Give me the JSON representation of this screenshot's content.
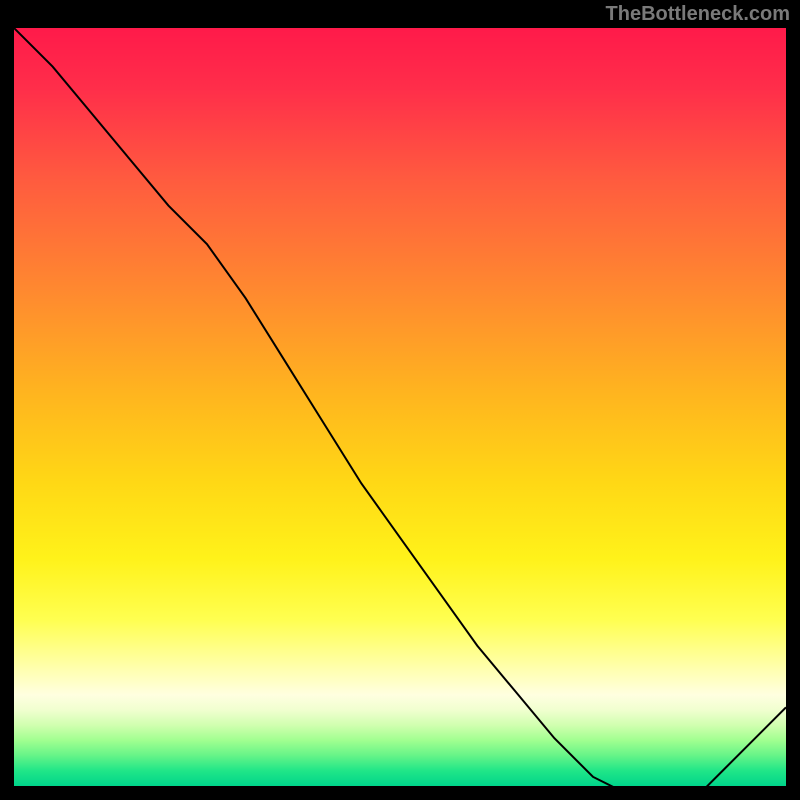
{
  "attribution": "TheBottleneck.com",
  "overlay_label": "",
  "chart_data": {
    "type": "line",
    "title": "",
    "xlabel": "",
    "ylabel": "",
    "xlim": [
      0,
      100
    ],
    "ylim": [
      0,
      100
    ],
    "series": [
      {
        "name": "curve",
        "x": [
          0,
          5,
          10,
          15,
          20,
          25,
          30,
          35,
          40,
          45,
          50,
          55,
          60,
          65,
          70,
          75,
          80,
          85,
          88,
          92,
          100
        ],
        "y": [
          100,
          95,
          89,
          83,
          77,
          72,
          65,
          57,
          49,
          41,
          34,
          27,
          20,
          14,
          8,
          3,
          0.5,
          0,
          0,
          4,
          12
        ]
      }
    ],
    "annotations": [
      {
        "text": "",
        "x": 83,
        "y": 1
      }
    ],
    "background_gradient": {
      "direction": "vertical",
      "stops": [
        {
          "pos": 0.0,
          "color": "#ff1a4a"
        },
        {
          "pos": 0.35,
          "color": "#ff8a2f"
        },
        {
          "pos": 0.6,
          "color": "#ffd815"
        },
        {
          "pos": 0.85,
          "color": "#ffffe0"
        },
        {
          "pos": 1.0,
          "color": "#00d48a"
        }
      ]
    }
  }
}
